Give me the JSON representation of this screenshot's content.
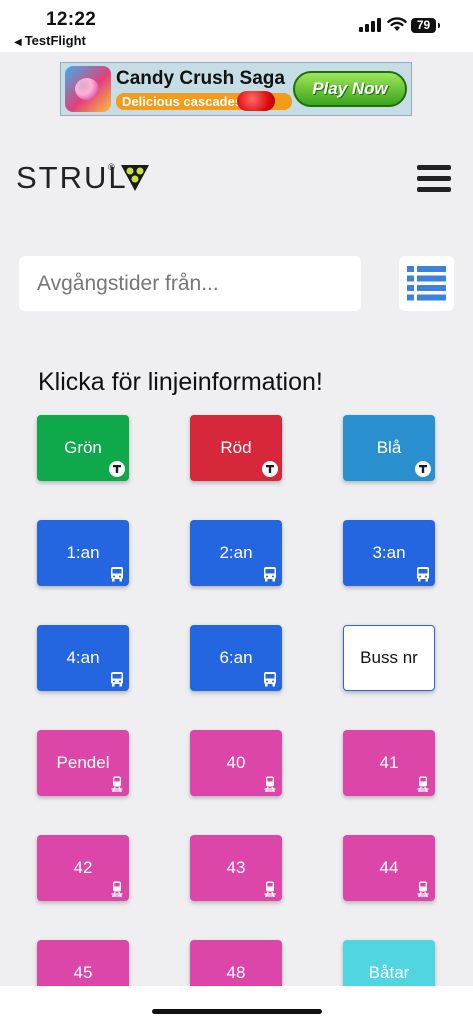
{
  "status": {
    "time": "12:22",
    "back_app": "TestFlight",
    "battery": "79"
  },
  "ad": {
    "title": "Candy Crush Saga",
    "subtitle": "Delicious cascades",
    "cta": "Play Now"
  },
  "header": {
    "logo": "STRUL",
    "registered": "®"
  },
  "search": {
    "placeholder": "Avgångstider från..."
  },
  "section": {
    "title": "Klicka för linjeinformation!"
  },
  "colors": {
    "green": "#0fa84a",
    "red": "#d6283a",
    "blue_line": "#2a8fcf",
    "bus": "#2466e0",
    "train": "#db46a8",
    "boat": "#4fd6e0"
  },
  "tiles": [
    {
      "label": "Grön",
      "icon": "metro-t-icon"
    },
    {
      "label": "Röd",
      "icon": "metro-t-icon"
    },
    {
      "label": "Blå",
      "icon": "metro-t-icon"
    },
    {
      "label": "1:an",
      "icon": "bus-icon"
    },
    {
      "label": "2:an",
      "icon": "bus-icon"
    },
    {
      "label": "3:an",
      "icon": "bus-icon"
    },
    {
      "label": "4:an",
      "icon": "bus-icon"
    },
    {
      "label": "6:an",
      "icon": "bus-icon"
    },
    {
      "label": "Buss nr",
      "icon": ""
    },
    {
      "label": "Pendel",
      "icon": "train-icon"
    },
    {
      "label": "40",
      "icon": "train-icon"
    },
    {
      "label": "41",
      "icon": "train-icon"
    },
    {
      "label": "42",
      "icon": "train-icon"
    },
    {
      "label": "43",
      "icon": "train-icon"
    },
    {
      "label": "44",
      "icon": "train-icon"
    },
    {
      "label": "45",
      "icon": "train-icon"
    },
    {
      "label": "48",
      "icon": "train-icon"
    },
    {
      "label": "Båtar",
      "icon": ""
    }
  ]
}
